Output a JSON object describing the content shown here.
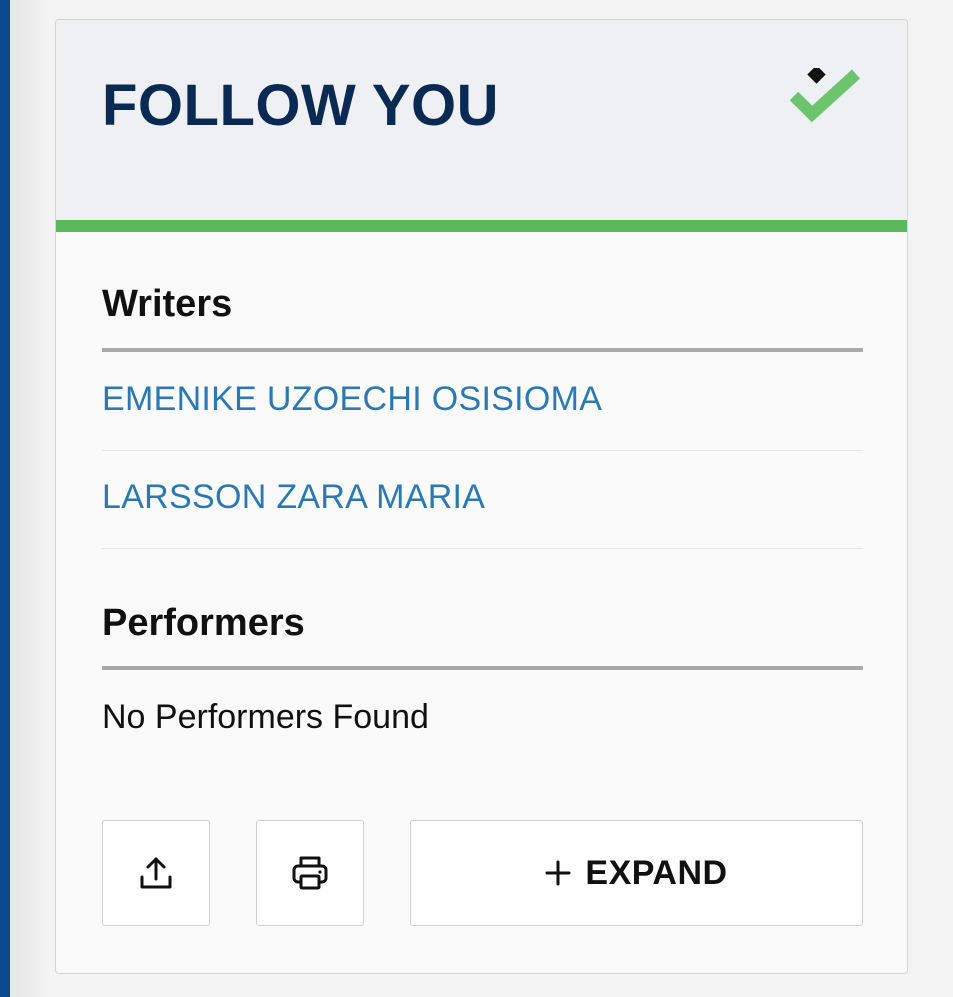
{
  "card": {
    "title": "FOLLOW YOU",
    "status_icon": "checkmark-with-diamond-icon",
    "colors": {
      "title": "#0a2a54",
      "accent_bar": "#5cb85c",
      "check": "#6cc56e",
      "diamond": "#111111",
      "link": "#2a79b5"
    }
  },
  "writers": {
    "heading": "Writers",
    "items": [
      {
        "name": "EMENIKE UZOECHI OSISIOMA"
      },
      {
        "name": "LARSSON ZARA MARIA"
      }
    ]
  },
  "performers": {
    "heading": "Performers",
    "empty_text": "No Performers Found"
  },
  "actions": {
    "share_icon": "share-upload-icon",
    "print_icon": "printer-icon",
    "expand_label": "EXPAND",
    "expand_icon": "plus-icon"
  }
}
